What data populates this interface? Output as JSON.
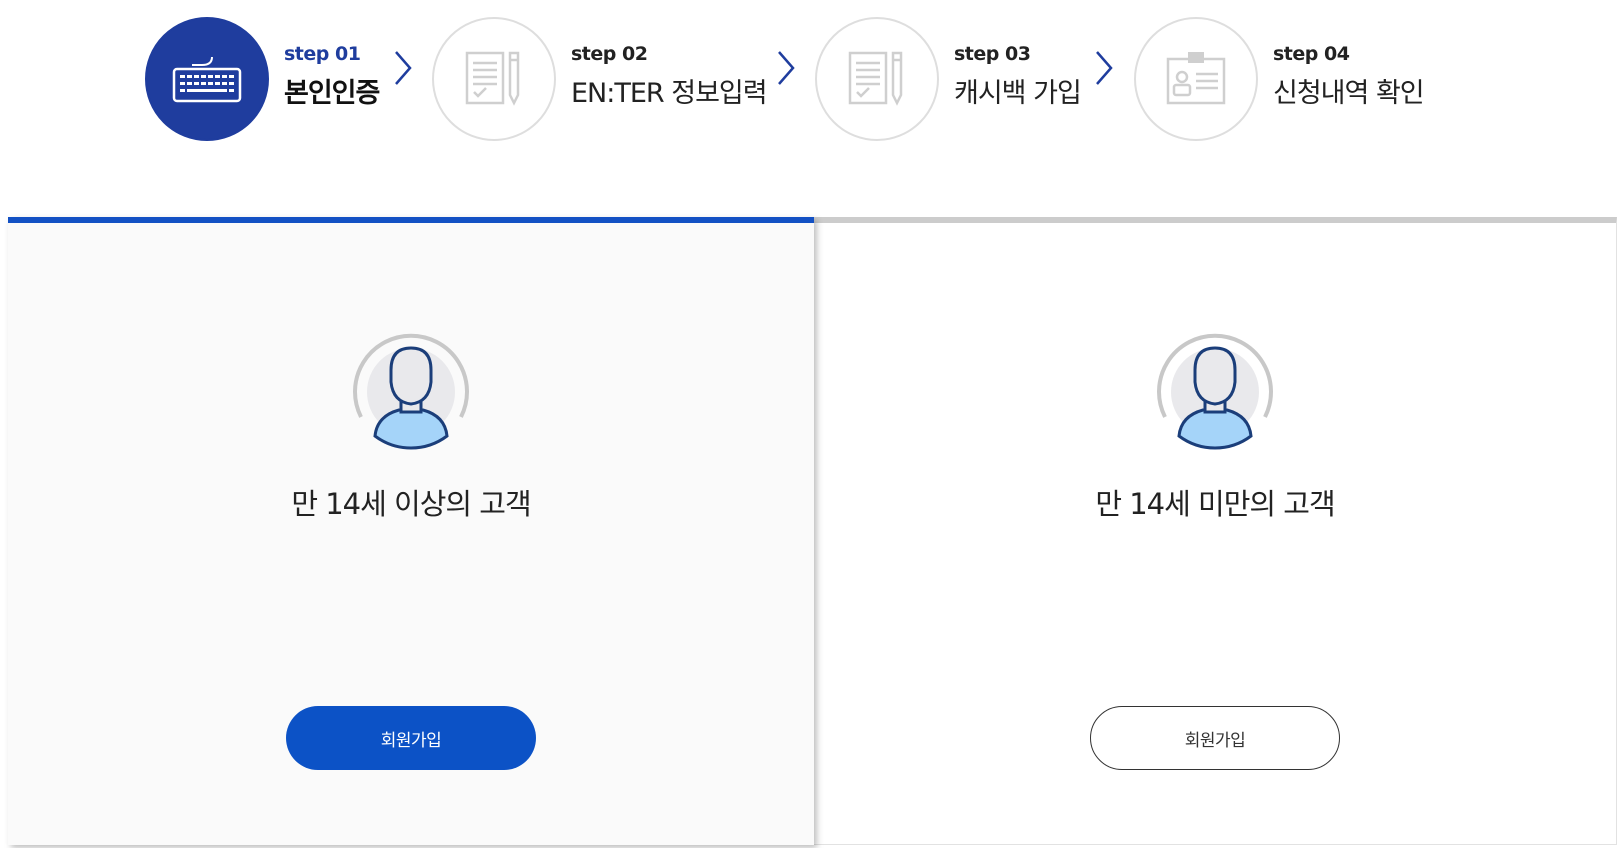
{
  "steps": [
    {
      "num": "step 01",
      "title": "본인인증",
      "icon": "keyboard-icon",
      "active": true
    },
    {
      "num": "step 02",
      "title": "EN:TER 정보입력",
      "icon": "document-pencil-icon",
      "active": false
    },
    {
      "num": "step 03",
      "title": "캐시백 가입",
      "icon": "document-pencil-icon",
      "active": false
    },
    {
      "num": "step 04",
      "title": "신청내역 확인",
      "icon": "id-card-icon",
      "active": false
    }
  ],
  "panels": {
    "adult": {
      "label": "만 14세 이상의 고객",
      "button": "회원가입",
      "icon": "user-avatar-icon"
    },
    "minor": {
      "label": "만 14세 미만의 고객",
      "button": "회원가입",
      "icon": "user-avatar-icon"
    }
  },
  "colors": {
    "active_step": "#1f3d9e",
    "accent_blue": "#0c52c6",
    "tab_active_border": "#1351c4",
    "tab_inactive_border": "#cccccc",
    "chevron": "#1f3d9e"
  }
}
